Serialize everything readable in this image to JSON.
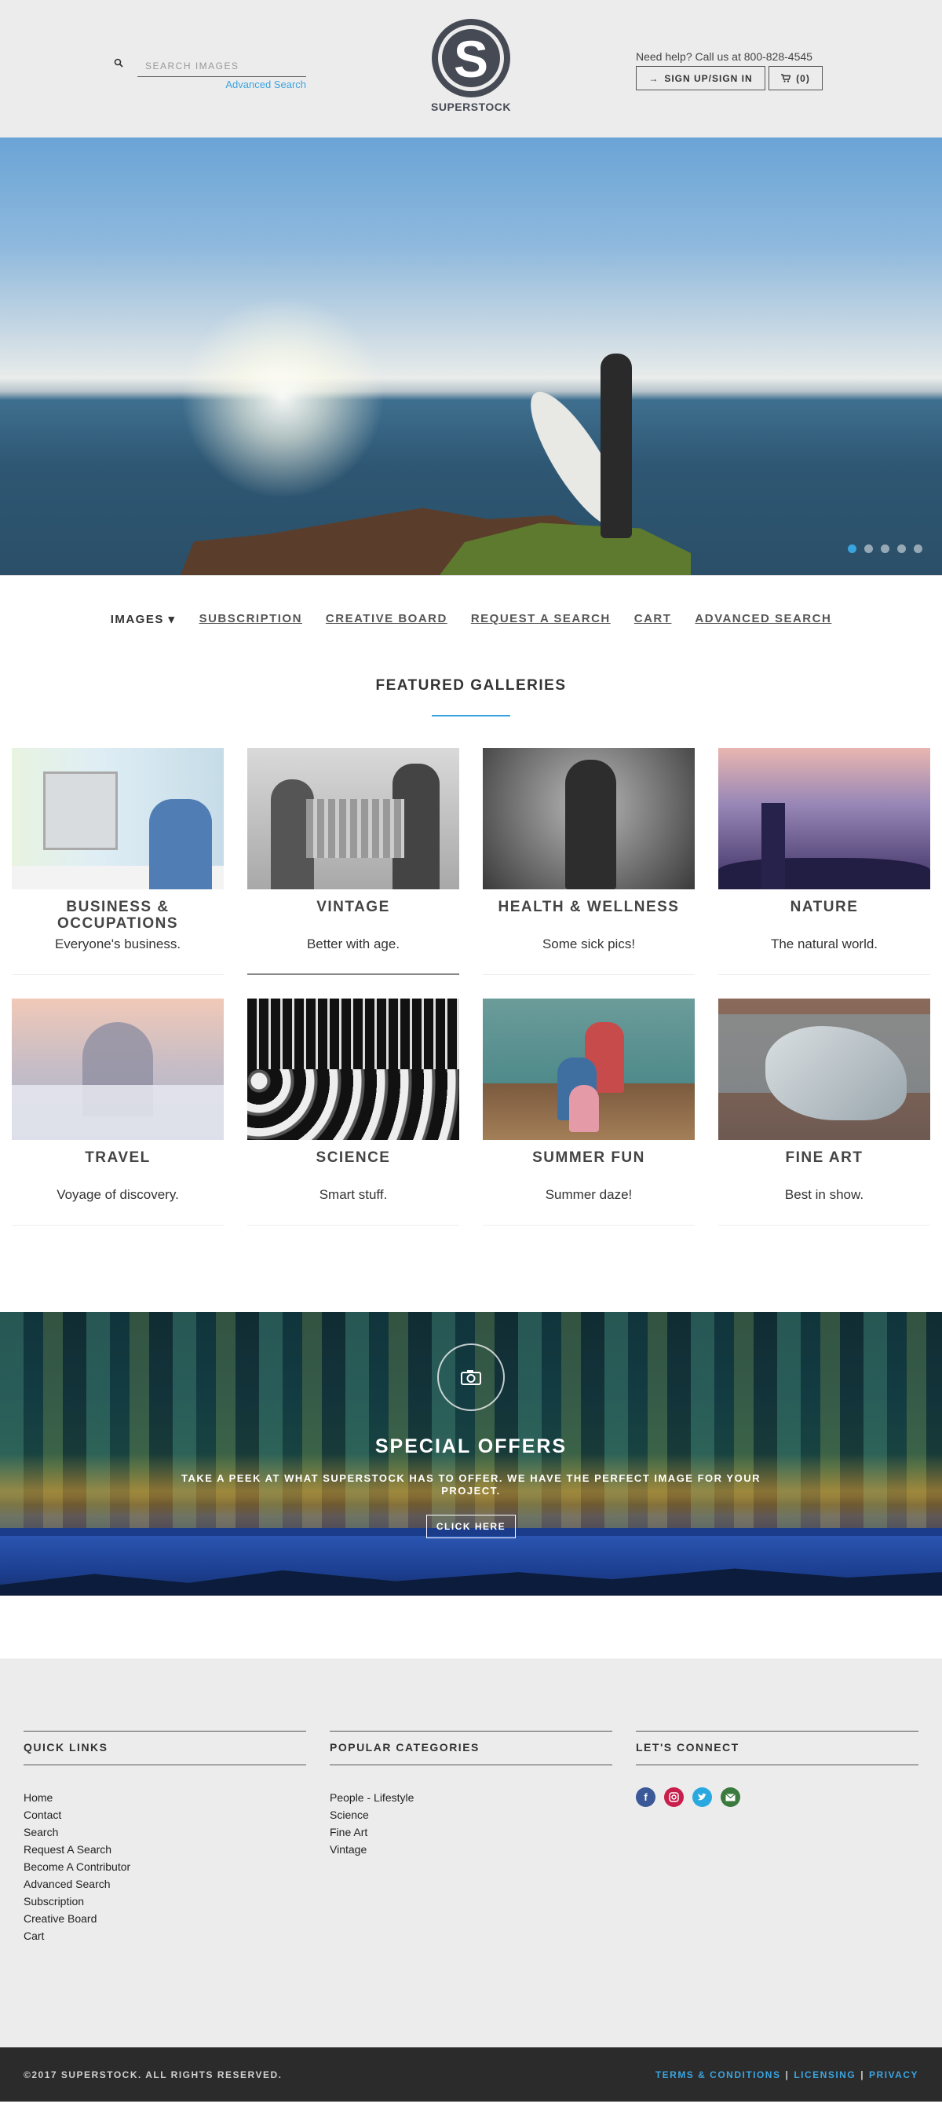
{
  "header": {
    "search_placeholder": "SEARCH IMAGES",
    "advanced_search": "Advanced Search",
    "logo_text": "SUPERSTOCK",
    "help_text": "Need help? Call us at 800-828-4545",
    "signin_label": "SIGN UP/SIGN IN",
    "cart_label": "(0)"
  },
  "hero": {
    "slide_count": 5,
    "active_slide": 1
  },
  "nav": {
    "items": [
      "IMAGES",
      "SUBSCRIPTION",
      "CREATIVE BOARD",
      "REQUEST A SEARCH",
      "CART",
      "ADVANCED SEARCH"
    ]
  },
  "featured": {
    "title": "FEATURED GALLERIES",
    "galleries": [
      {
        "title": "BUSINESS & OCCUPATIONS",
        "desc": "Everyone's business."
      },
      {
        "title": "VINTAGE",
        "desc": "Better with age."
      },
      {
        "title": "HEALTH & WELLNESS",
        "desc": "Some sick pics!"
      },
      {
        "title": "NATURE",
        "desc": "The natural world."
      },
      {
        "title": "TRAVEL",
        "desc": "Voyage of discovery."
      },
      {
        "title": "SCIENCE",
        "desc": "Smart stuff."
      },
      {
        "title": "SUMMER FUN",
        "desc": "Summer daze!"
      },
      {
        "title": "FINE ART",
        "desc": "Best in show."
      }
    ]
  },
  "offers": {
    "title": "SPECIAL OFFERS",
    "subtitle": "TAKE A PEEK AT WHAT SUPERSTOCK HAS TO OFFER. WE HAVE THE PERFECT IMAGE FOR YOUR PROJECT.",
    "button": "CLICK HERE"
  },
  "footer": {
    "quick_links_title": "QUICK LINKS",
    "quick_links": [
      "Home",
      "Contact",
      "Search",
      "Request A Search",
      "Become A Contributor",
      "Advanced Search",
      "Subscription",
      "Creative Board",
      "Cart"
    ],
    "popular_title": "POPULAR CATEGORIES",
    "popular": [
      "People - Lifestyle",
      "Science",
      "Fine Art",
      "Vintage"
    ],
    "connect_title": "LET'S CONNECT",
    "social": [
      "facebook-icon",
      "instagram-icon",
      "twitter-icon",
      "email-icon"
    ],
    "copyright": "©2017 SUPERSTOCK. ALL RIGHTS RESERVED.",
    "legal": [
      "TERMS & CONDITIONS",
      "LICENSING",
      "PRIVACY"
    ]
  },
  "colors": {
    "accent": "#3aa4e0",
    "header_bg": "#ececec",
    "footer_bar": "#2b2b2b",
    "logo": "#454a54"
  }
}
